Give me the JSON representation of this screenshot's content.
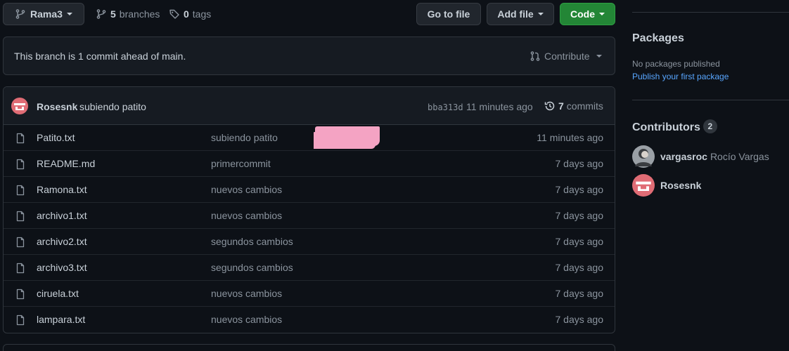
{
  "toolbar": {
    "branch_label": "Rama3",
    "branches_count": "5",
    "branches_label": "branches",
    "tags_count": "0",
    "tags_label": "tags",
    "go_to_file": "Go to file",
    "add_file": "Add file",
    "code": "Code"
  },
  "branch_info": {
    "message": "This branch is 1 commit ahead of main.",
    "contribute": "Contribute"
  },
  "latest_commit": {
    "author": "Rosesnk",
    "message": "subiendo patito",
    "sha": "bba313d",
    "time": "11 minutes ago",
    "commits_count": "7",
    "commits_label": "commits"
  },
  "files": [
    {
      "name": "Patito.txt",
      "message": "subiendo patito",
      "date": "11 minutes ago"
    },
    {
      "name": "README.md",
      "message": "primercommit",
      "date": "7 days ago"
    },
    {
      "name": "Ramona.txt",
      "message": "nuevos cambios",
      "date": "7 days ago"
    },
    {
      "name": "archivo1.txt",
      "message": "nuevos cambios",
      "date": "7 days ago"
    },
    {
      "name": "archivo2.txt",
      "message": "segundos cambios",
      "date": "7 days ago"
    },
    {
      "name": "archivo3.txt",
      "message": "segundos cambios",
      "date": "7 days ago"
    },
    {
      "name": "ciruela.txt",
      "message": "nuevos cambios",
      "date": "7 days ago"
    },
    {
      "name": "lampara.txt",
      "message": "nuevos cambios",
      "date": "7 days ago"
    }
  ],
  "packages": {
    "title": "Packages",
    "empty": "No packages published",
    "publish_link": "Publish your first package"
  },
  "contributors": {
    "title": "Contributors",
    "count": "2",
    "people": [
      {
        "login": "vargasroc",
        "name": "Rocío Vargas"
      },
      {
        "login": "Rosesnk",
        "name": ""
      }
    ]
  },
  "colors": {
    "background": "#0d1117",
    "panel": "#161b22",
    "border": "#30363d",
    "accent_link": "#58a6ff",
    "code_button": "#238636",
    "redaction": "#f4a3c3"
  }
}
